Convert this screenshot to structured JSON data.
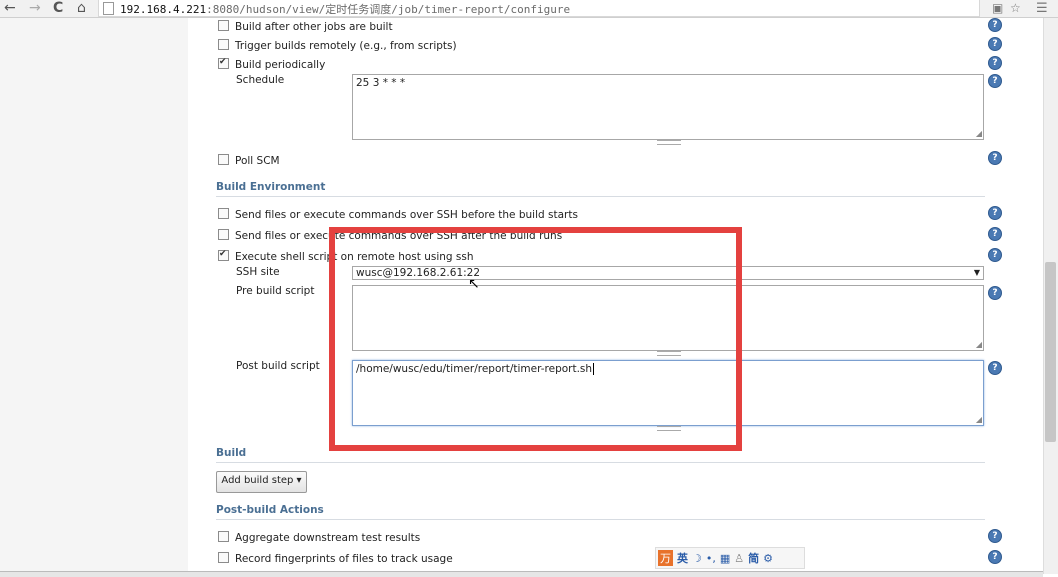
{
  "browser": {
    "back_icon": "←",
    "forward_icon": "→",
    "reload_icon": "C",
    "home_icon": "⌂",
    "url_host": "192.168.4.221",
    "url_rest": ":8080/hudson/view/定时任务调度/job/timer-report/configure",
    "menu_icon": "☰",
    "star_icon": "☆"
  },
  "triggers": {
    "build_after_label": "Build after other jobs are built",
    "trigger_remote_label": "Trigger builds remotely (e.g., from scripts)",
    "build_periodically_label": "Build periodically",
    "schedule_label": "Schedule",
    "schedule_value": "25 3 * * *",
    "poll_scm_label": "Poll SCM"
  },
  "build_environment": {
    "section_title": "Build Environment",
    "ssh_before_label": "Send files or execute commands over SSH before the build starts",
    "ssh_after_label": "Send files or execute commands over SSH after the build runs",
    "exec_remote_label": "Execute shell script on remote host using ssh",
    "ssh_site_label": "SSH site",
    "ssh_site_value": "wusc@192.168.2.61:22",
    "pre_build_label": "Pre build script",
    "pre_build_value": "",
    "post_build_label": "Post build script",
    "post_build_value": "/home/wusc/edu/timer/report/timer-report.sh"
  },
  "build": {
    "section_title": "Build",
    "add_step_label": "Add build step ▾"
  },
  "post_build": {
    "section_title": "Post-build Actions",
    "aggregate_label": "Aggregate downstream test results",
    "fingerprint_label": "Record fingerprints of files to track usage"
  },
  "ime": {
    "items": [
      "万",
      "英",
      "☽",
      "•,",
      "▦",
      "♙",
      "简",
      "⚙"
    ]
  },
  "help_glyph": "?",
  "colors": {
    "section_title": "#4a6f93",
    "help_icon": "#4a79b3",
    "highlight_box": "#e4413f"
  }
}
